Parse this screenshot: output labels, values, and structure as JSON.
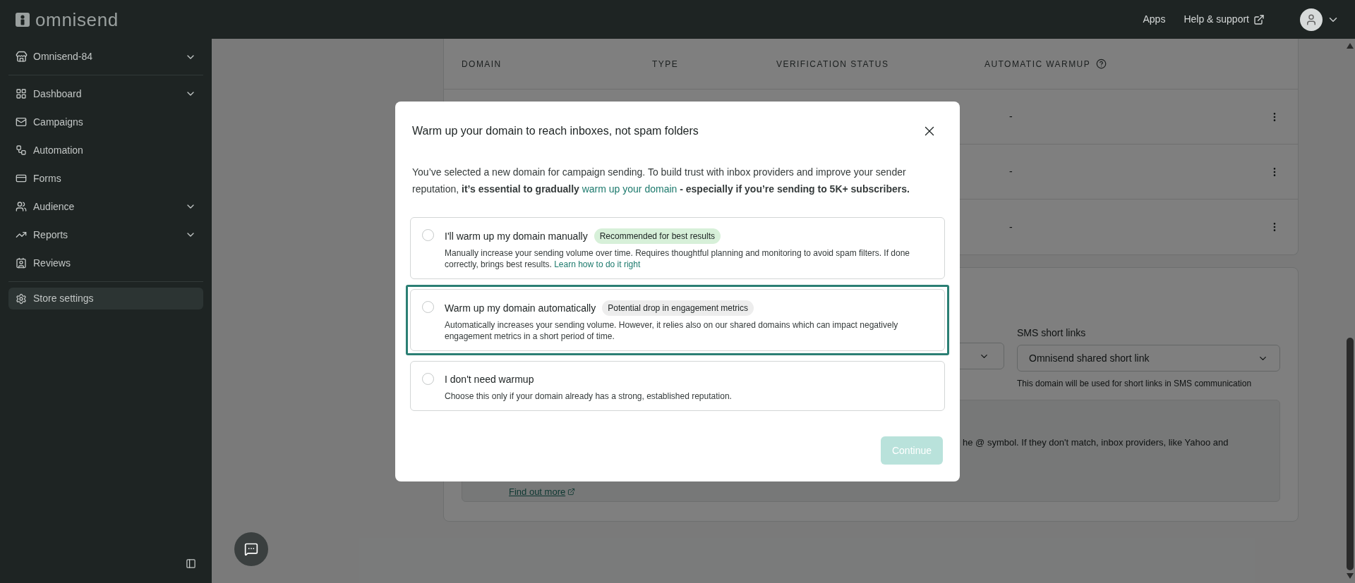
{
  "topbar": {
    "logo": "omnisend",
    "links": [
      {
        "label": "Apps",
        "external": false
      },
      {
        "label": "Help & support",
        "external": true
      }
    ]
  },
  "sidebar": {
    "store": "Omnisend-84",
    "items": [
      {
        "label": "Dashboard",
        "submenu": true,
        "selected": false
      },
      {
        "label": "Campaigns",
        "submenu": false,
        "selected": false
      },
      {
        "label": "Automation",
        "submenu": false,
        "selected": false
      },
      {
        "label": "Forms",
        "submenu": false,
        "selected": false
      },
      {
        "label": "Audience",
        "submenu": true,
        "selected": false
      },
      {
        "label": "Reports",
        "submenu": true,
        "selected": false
      },
      {
        "label": "Reviews",
        "submenu": false,
        "selected": false
      }
    ],
    "settings": {
      "label": "Store settings",
      "selected": true
    }
  },
  "table": {
    "columns": [
      "DOMAIN",
      "TYPE",
      "VERIFICATION STATUS",
      "AUTOMATIC WARMUP"
    ],
    "rows": [
      {
        "automatic_warmup": "-"
      },
      {
        "automatic_warmup": "-"
      },
      {
        "automatic_warmup": "-"
      }
    ]
  },
  "sms_short_links": {
    "label": "SMS short links",
    "value": "Omnisend shared short link",
    "helper": "This domain will be used for short links in SMS communication"
  },
  "notice": {
    "text": "he @ symbol. If they don't match, inbox providers, like Yahoo and",
    "link": "Find out more"
  },
  "modal": {
    "title": "Warm up your domain to reach inboxes, not spam folders",
    "intro_before": "You’ve selected a new domain for campaign sending. To build trust with inbox providers and improve your sender reputation, **it’s essential to gradually**",
    "intro_link": "warm up your domain",
    "intro_after": "**- especially if you’re sending to 5K+ subscribers.**",
    "options": [
      {
        "title": "I'll warm up my domain manually",
        "badge": {
          "text": "Recommended for best results",
          "color": "#d7f0d9"
        },
        "description": "Manually increase your sending volume over time. Requires thoughtful planning and monitoring to avoid spam filters. If done correctly, brings best results.",
        "link": "Learn how to do it right",
        "selected": false,
        "focused": false
      },
      {
        "title": "Warm up my domain automatically",
        "badge": {
          "text": "Potential drop in engagement metrics",
          "color": "#ededed"
        },
        "description": "Automatically increases your sending volume. However, it relies also on our shared domains which can impact negatively engagement metrics in a short period of time.",
        "selected": false,
        "focused": true
      },
      {
        "title": "I don't need warmup",
        "description": "Choose this only if your domain already has a strong, established reputation.",
        "selected": false,
        "focused": false
      }
    ],
    "continue": {
      "label": "Continue",
      "disabled": true
    }
  }
}
